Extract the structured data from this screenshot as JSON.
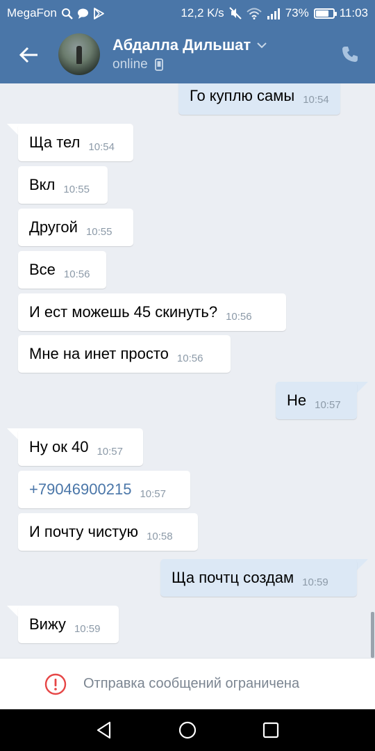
{
  "status_bar": {
    "carrier": "MegaFon",
    "speed": "12,2 K/s",
    "battery": "73%",
    "battery_level": 0.73,
    "time": "11:03"
  },
  "header": {
    "contact_name": "Абдалла Дильшат",
    "status": "online",
    "icons": [
      "back-arrow-icon",
      "chevron-down-icon",
      "mobile-icon",
      "phone-icon"
    ]
  },
  "messages": [
    {
      "dir": "out",
      "text": "Го куплю самы",
      "time": "10:54"
    },
    {
      "dir": "in",
      "text": "Ща тел",
      "time": "10:54"
    },
    {
      "dir": "in",
      "text": "Вкл",
      "time": "10:55"
    },
    {
      "dir": "in",
      "text": "Другой",
      "time": "10:55"
    },
    {
      "dir": "in",
      "text": "Все",
      "time": "10:56"
    },
    {
      "dir": "in",
      "text": "И ест можешь 45 скинуть?",
      "time": "10:56"
    },
    {
      "dir": "in",
      "text": "Мне на инет просто",
      "time": "10:56"
    },
    {
      "dir": "out",
      "text": "Не",
      "time": "10:57"
    },
    {
      "dir": "in",
      "text": "Ну ок 40",
      "time": "10:57"
    },
    {
      "dir": "in",
      "text": "+79046900215",
      "time": "10:57",
      "link": true
    },
    {
      "dir": "in",
      "text": "И почту чистую",
      "time": "10:58"
    },
    {
      "dir": "out",
      "text": "Ща почтц создам",
      "time": "10:59"
    },
    {
      "dir": "in",
      "text": "Вижу",
      "time": "10:59"
    }
  ],
  "restriction": {
    "text": "Отправка сообщений ограничена",
    "icon": "alert-circle-icon",
    "icon_color": "#e64646"
  },
  "colors": {
    "header": "#4a76a8",
    "background": "#ebeef3",
    "incoming": "#ffffff",
    "outgoing": "#dce8f5",
    "link": "#4a76a8"
  },
  "nav": [
    "back-triangle-icon",
    "home-circle-icon",
    "recents-square-icon"
  ]
}
